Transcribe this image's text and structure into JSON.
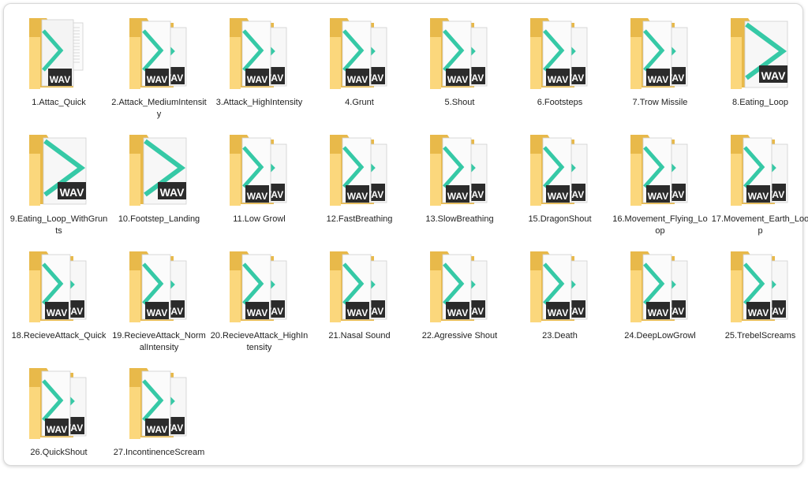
{
  "files": [
    {
      "name": "1.Attac_Quick",
      "icon": "folder-text-doc-icon"
    },
    {
      "name": "2.Attack_MediumIntensity",
      "icon": "folder-wav-icon"
    },
    {
      "name": "3.Attack_HighIntensity",
      "icon": "folder-wav-icon"
    },
    {
      "name": "4.Grunt",
      "icon": "folder-wav-icon"
    },
    {
      "name": "5.Shout",
      "icon": "folder-wav-icon"
    },
    {
      "name": "6.Footsteps",
      "icon": "folder-wav-icon"
    },
    {
      "name": "7.Trow Missile",
      "icon": "folder-wav-icon"
    },
    {
      "name": "8.Eating_Loop",
      "icon": "folder-single-wav-icon"
    },
    {
      "name": "9.Eating_Loop_WithGrunts",
      "icon": "folder-single-wav-icon"
    },
    {
      "name": "10.Footstep_Landing",
      "icon": "folder-single-wav-icon"
    },
    {
      "name": "11.Low Growl",
      "icon": "folder-wav-icon"
    },
    {
      "name": "12.FastBreathing",
      "icon": "folder-wav-icon"
    },
    {
      "name": "13.SlowBreathing",
      "icon": "folder-wav-icon"
    },
    {
      "name": "15.DragonShout",
      "icon": "folder-wav-icon"
    },
    {
      "name": "16.Movement_Flying_Loop",
      "icon": "folder-wav-icon"
    },
    {
      "name": "17.Movement_Earth_Loop",
      "icon": "folder-wav-icon"
    },
    {
      "name": "18.RecieveAttack_Quick",
      "icon": "folder-wav-icon"
    },
    {
      "name": "19.RecieveAttack_NormalIntensity",
      "icon": "folder-wav-icon"
    },
    {
      "name": "20.RecieveAttack_HighIntensity",
      "icon": "folder-wav-icon"
    },
    {
      "name": "21.Nasal Sound",
      "icon": "folder-wav-icon"
    },
    {
      "name": "22.Agressive Shout",
      "icon": "folder-wav-icon"
    },
    {
      "name": "23.Death",
      "icon": "folder-wav-icon"
    },
    {
      "name": "24.DeepLowGrowl",
      "icon": "folder-wav-icon"
    },
    {
      "name": "25.TrebelScreams",
      "icon": "folder-wav-icon"
    },
    {
      "name": "26.QuickShout",
      "icon": "folder-wav-icon"
    },
    {
      "name": "27.IncontinenceScream",
      "icon": "folder-wav-icon"
    }
  ],
  "wav_badge": "WAV",
  "colors": {
    "folder_back": "#e8b94a",
    "folder_front": "#fbd77c",
    "paper": "#f7f7f7",
    "teal": "#36c9a6",
    "badge": "#2b2b2b"
  }
}
